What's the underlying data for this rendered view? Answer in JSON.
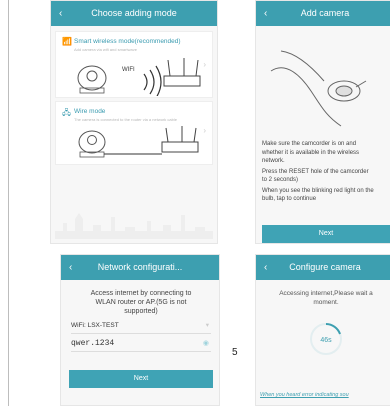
{
  "screen1": {
    "title": "Choose adding mode",
    "smart": {
      "label": "Smart wireless mode(recommended)",
      "sub": "Add camera via wifi and smartwave",
      "wifi_text": "WIFI"
    },
    "wire": {
      "label": "Wire mode",
      "sub": "The camera is connected to the router via a network cable"
    }
  },
  "screen2": {
    "title": "Add camera",
    "lines": [
      "Make sure the camcorder is on and",
      "whether it is available in the wireless",
      "network.",
      "Press the RESET hole of the camcorder",
      "to 2 seconds)",
      "When you see the blinking red light on the",
      "bulb, tap to continue"
    ],
    "next": "Next"
  },
  "screen3": {
    "title": "Network configurati...",
    "message": [
      "Access internet by connecting to",
      "WLAN router or AP.(5G is not",
      "supported)"
    ],
    "wifi_label": "WiFi: LSX-TEST",
    "password": "qwer.1234",
    "next": "Next"
  },
  "screen4": {
    "title": "Configure camera",
    "message": [
      "Accessing internet,Please wait a",
      "moment."
    ],
    "countdown": "46s",
    "link": "When you heard error indicating sou"
  },
  "page_number": "5"
}
